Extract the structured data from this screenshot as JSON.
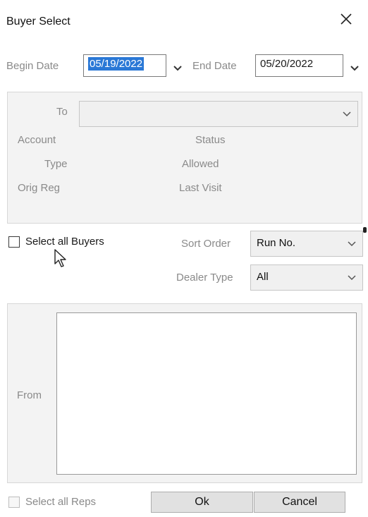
{
  "window": {
    "title": "Buyer Select",
    "close_icon": "close-icon"
  },
  "dates": {
    "begin_label": "Begin Date",
    "begin_value": "05/19/2022",
    "end_label": "End Date",
    "end_value": "05/20/2022"
  },
  "details": {
    "to_label": "To",
    "to_value": "",
    "account_label": "Account",
    "status_label": "Status",
    "type_label": "Type",
    "allowed_label": "Allowed",
    "orig_reg_label": "Orig Reg",
    "last_visit_label": "Last Visit"
  },
  "options": {
    "select_all_buyers_label": "Select all Buyers",
    "select_all_buyers_checked": false,
    "sort_order_label": "Sort Order",
    "sort_order_value": "Run No.",
    "dealer_type_label": "Dealer Type",
    "dealer_type_value": "All"
  },
  "from": {
    "label": "From",
    "items": []
  },
  "footer": {
    "select_all_reps_label": "Select all Reps",
    "select_all_reps_checked": false,
    "ok_label": "Ok",
    "cancel_label": "Cancel"
  },
  "colors": {
    "selection": "#2a78d6",
    "group_bg": "#f3f3f3",
    "button_bg": "#e1e1e1"
  }
}
